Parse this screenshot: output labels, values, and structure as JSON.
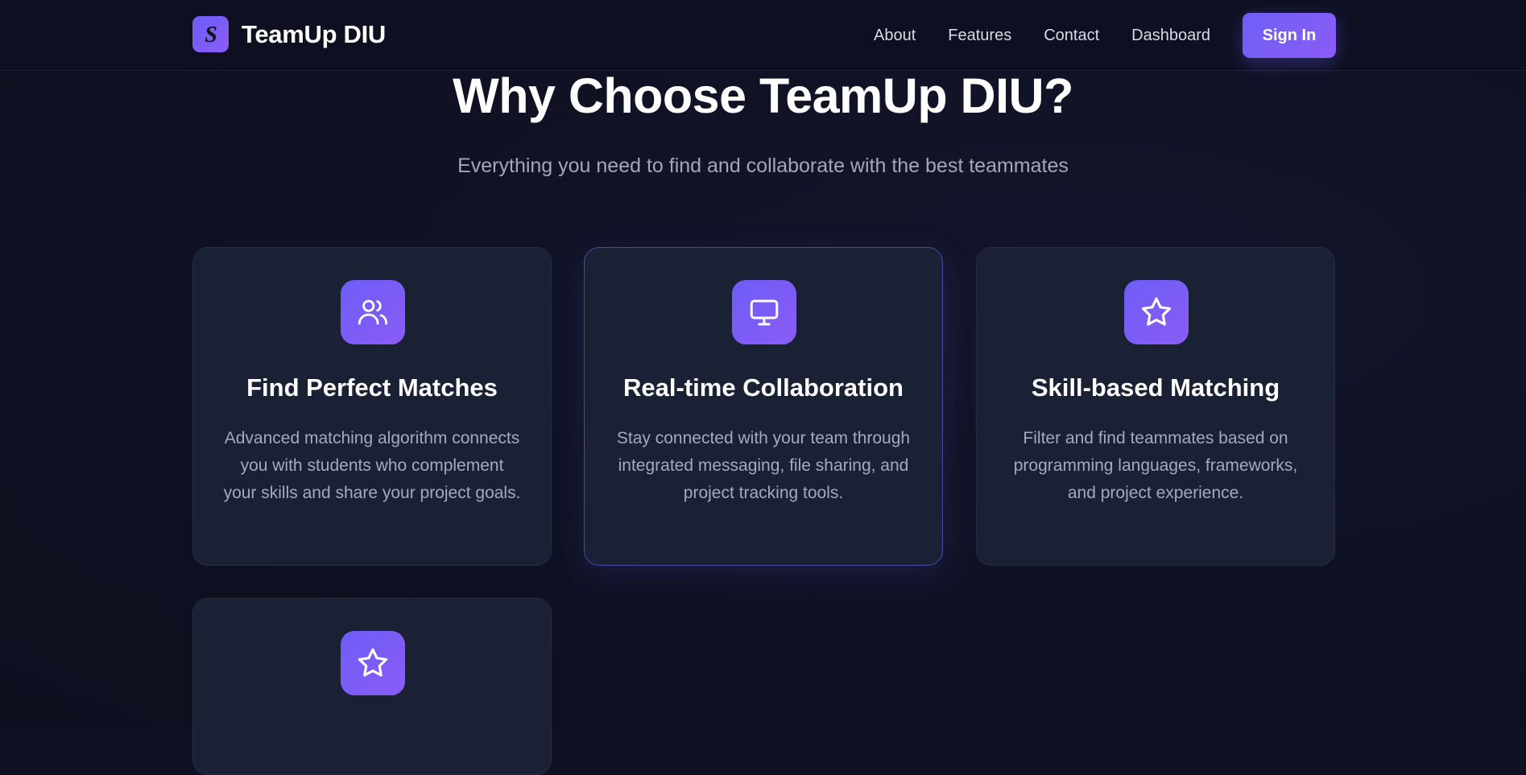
{
  "brand": {
    "name": "TeamUp DIU",
    "logo_glyph": "S",
    "icon": "brand-logo-icon"
  },
  "nav": {
    "links": [
      "About",
      "Features",
      "Contact",
      "Dashboard"
    ],
    "signin_label": "Sign In"
  },
  "section": {
    "title": "Why Choose TeamUp DIU?",
    "subtitle": "Everything you need to find and collaborate with the best teammates"
  },
  "features": [
    {
      "icon": "users-icon",
      "title": "Find Perfect Matches",
      "description": "Advanced matching algorithm connects you with students who complement your skills and share your project goals."
    },
    {
      "icon": "monitor-icon",
      "title": "Real-time Collaboration",
      "description": "Stay connected with your team through integrated messaging, file sharing, and project tracking tools."
    },
    {
      "icon": "star-icon",
      "title": "Skill-based Matching",
      "description": "Filter and find teammates based on programming languages, frameworks, and project experience."
    },
    {
      "icon": "star-icon",
      "title": "",
      "description": ""
    }
  ],
  "colors": {
    "background": "#0f1122",
    "card": "#1b2135",
    "accent_start": "#6d5df6",
    "accent_end": "#8b5cf6",
    "muted_text": "#a6a9ba"
  }
}
